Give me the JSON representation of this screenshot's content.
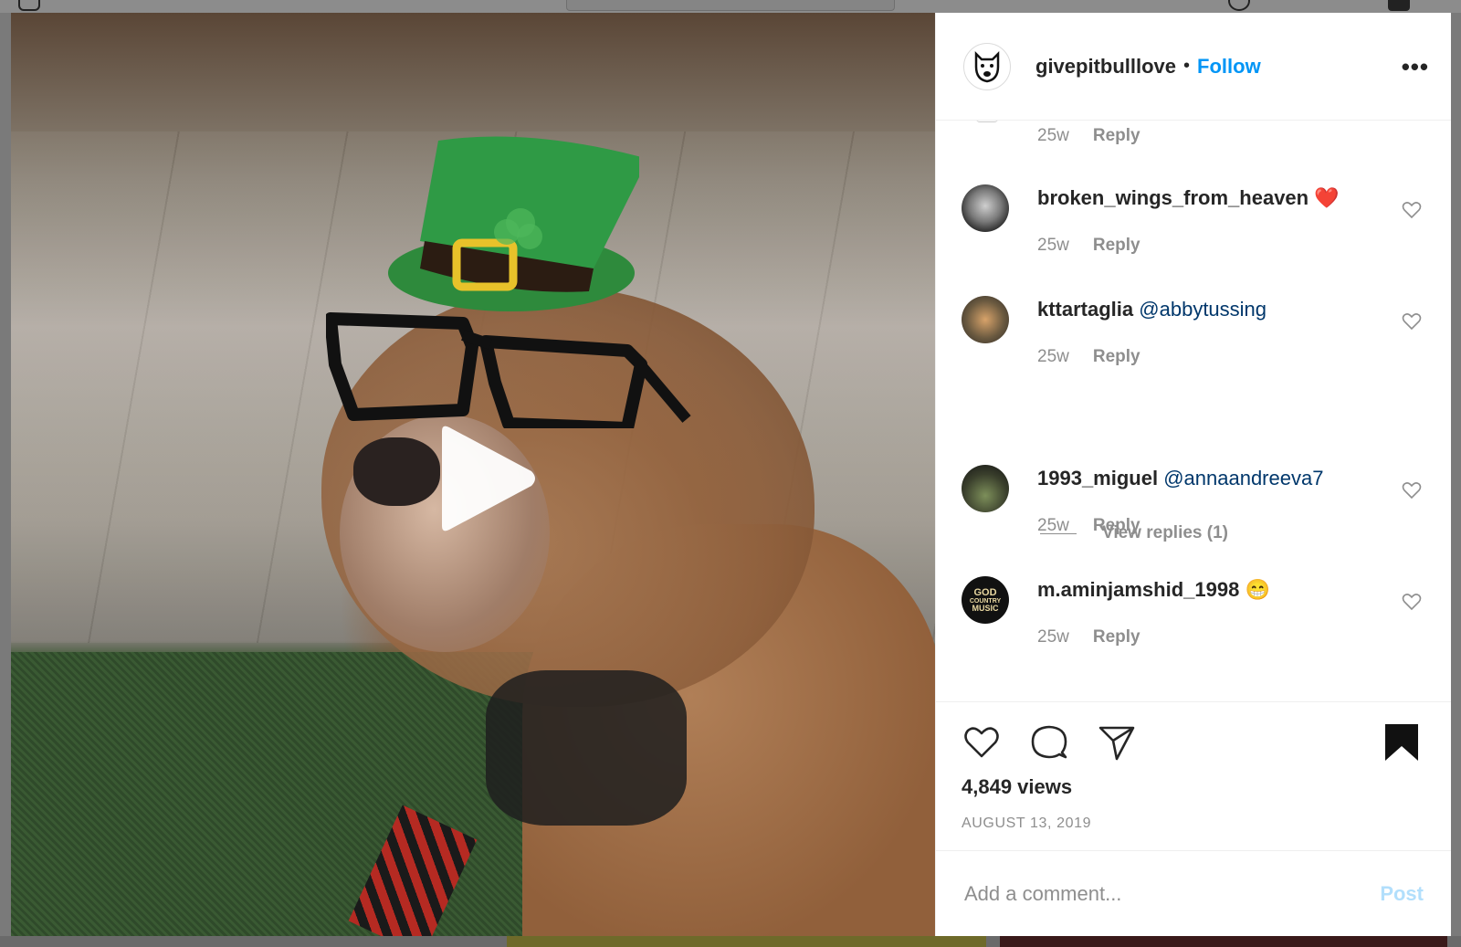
{
  "post": {
    "username": "givepitbulllove",
    "separator": "•",
    "follow_label": "Follow",
    "more_label": "•••",
    "views": "4,849 views",
    "date": "AUGUST 13, 2019"
  },
  "partial_comment": {
    "time": "25w",
    "reply_label": "Reply"
  },
  "comments": [
    {
      "username": "broken_wings_from_heaven",
      "text": "",
      "emoji": "❤️",
      "time": "25w",
      "reply_label": "Reply"
    },
    {
      "username": "kttartaglia",
      "text": "@abbytussing",
      "emoji": "",
      "time": "25w",
      "reply_label": "Reply"
    },
    {
      "username": "1993_miguel",
      "text": "@annaandreeva7",
      "emoji": "",
      "time": "25w",
      "reply_label": "Reply"
    },
    {
      "username": "m.aminjamshid_1998",
      "text": "",
      "emoji": "😁",
      "time": "25w",
      "reply_label": "Reply"
    }
  ],
  "view_replies": "View replies (1)",
  "composer": {
    "placeholder": "Add a comment...",
    "post_label": "Post"
  },
  "avatar_badge": {
    "line1": "GOD",
    "line2": "COUNTRY",
    "line3": "MUSIC"
  },
  "icons": {
    "play": "play-icon",
    "like": "heart-icon",
    "comment": "comment-icon",
    "share": "paper-plane-icon",
    "save": "bookmark-icon"
  },
  "colors": {
    "follow": "#0095f6",
    "mention": "#00376b",
    "muted": "#8e8e8e",
    "post_disabled": "#b2dffc"
  }
}
